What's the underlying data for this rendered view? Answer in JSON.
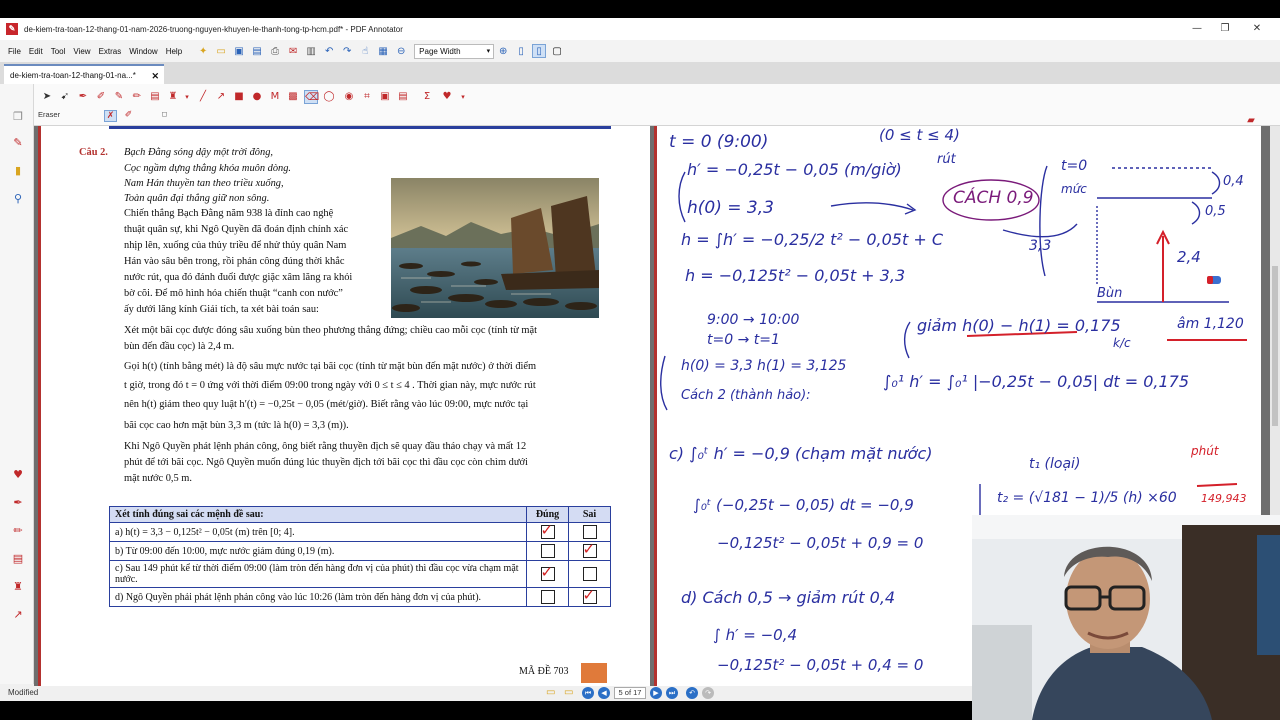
{
  "window": {
    "title": "de-kiem-tra-toan-12-thang-01-nam-2026-truong-nguyen-khuyen-le-thanh-tong-tp-hcm.pdf* - PDF Annotator",
    "app_icon": "pdf-annotator-icon"
  },
  "menu": {
    "items": [
      "File",
      "Edit",
      "Tool",
      "View",
      "Extras",
      "Window",
      "Help"
    ],
    "zoom_select": "Page Width"
  },
  "tab": {
    "label": "de-kiem-tra-toan-12-thang-01-na...*"
  },
  "toolbar": {
    "eraser_label": "Eraser"
  },
  "document": {
    "question_label": "Câu 2.",
    "poem": [
      "Bạch Đằng sóng dậy một trời đông,",
      "Cọc ngầm dựng thẳng khóa muôn dòng.",
      "Nam Hán thuyền tan theo triều xuống,",
      "Toàn quân đại thắng giữ non sông."
    ],
    "intro_lines": [
      "Chiến thắng Bạch Đằng năm 938 là đỉnh cao nghệ",
      "thuật quân sự, khi Ngô Quyền đã đoán định chính xác",
      "nhịp lên, xuống của thủy triều để nhử thủy quân Nam",
      "Hán vào sâu bên trong, rồi phản công đúng thời khắc",
      "nước rút, qua đó đánh đuổi được giặc xâm lăng ra khỏi",
      "bờ cõi. Để mô hình hóa chiến thuật “canh con nước”",
      "ấy dưới lăng kính Giải tích, ta xét bài toán sau:"
    ],
    "para1": [
      "Xét một bãi cọc được đóng sâu xuống bùn theo phương thẳng đứng; chiều cao mỗi cọc (tính từ mặt",
      "bùn đến đầu cọc) là  2,4 m."
    ],
    "para2": [
      "Gọi  h(t) (tính bằng mét) là độ sâu mực nước tại bãi cọc (tính từ mặt bùn đến mặt nước) ở thời điểm",
      "t giờ, trong đó  t = 0  ứng với thời điểm 09:00 trong ngày với  0 ≤ t ≤ 4 . Thời gian này, mực nước rút",
      "nên  h(t)  giảm theo quy luật  h′(t) = −0,25t − 0,05  (mét/giờ). Biết rằng vào lúc 09:00, mực nước tại",
      "bãi cọc cao hơn mặt bùn 3,3 m (tức là  h(0) = 3,3  (m))."
    ],
    "para3": [
      "Khi Ngô Quyền phát lệnh phản công, ông biết rằng thuyền địch sẽ quay đầu tháo chạy và mất 12",
      "phút để tới bãi cọc. Ngô Quyền muốn đúng lúc thuyền địch tới bãi cọc thì đầu cọc còn chìm dưới",
      "mặt nước 0,5 m."
    ],
    "table": {
      "header": [
        "Xét tính đúng sai các mệnh đề sau:",
        "Đúng",
        "Sai"
      ],
      "rows": [
        {
          "text": "a)  h(t) = 3,3 − 0,125t² − 0,05t  (m) trên [0; 4].",
          "true_checked": true,
          "false_checked": false
        },
        {
          "text": "b)  Từ 09:00 đến 10:00, mực nước giảm đúng 0,19 (m).",
          "true_checked": false,
          "false_checked": true
        },
        {
          "text": "c)  Sau 149 phút kể từ thời điểm 09:00 (làm tròn đến hàng đơn vị của phút) thì đầu cọc vừa chạm mặt nước.",
          "true_checked": true,
          "false_checked": false
        },
        {
          "text": "d)  Ngô Quyền phải phát lệnh phản công vào lúc 10:26 (làm tròn đến hàng đơn vị của phút).",
          "true_checked": false,
          "false_checked": true
        }
      ]
    },
    "footer_code": "MÃ ĐỀ 703"
  },
  "handwriting": {
    "lines": [
      "t = 0  (9:00)",
      "(0 ≤ t ≤ 4)",
      "h′ = −0,25t − 0,05  (m/giờ)",
      "rút",
      "h(0) = 3,3",
      "CÁCH 0,9",
      "h = ∫h′ = −0,25/2 t² − 0,05t + C",
      "h = −0,125t² − 0,05t + 3,3",
      "t=0",
      "mức",
      "0,4",
      "0,5",
      "3,3",
      "2,4",
      "Bùn",
      "9:00 → 10:00",
      "t=0 → t=1",
      "giảm  h(0) − h(1) = 0,175",
      "h(0) = 3,3    h(1) = 3,125",
      "k/c",
      "âm 1,120",
      "Cách 2 (thành hảo):",
      "∫₀¹ h′ = ∫₀¹ |−0,25t − 0,05| dt = 0,175",
      "c)  ∫₀ᵗ h′ = −0,9  (chạm mặt nước)",
      "∫₀ᵗ (−0,25t − 0,05) dt = −0,9",
      "−0,125t² − 0,05t + 0,9 = 0",
      "t₁ (loại)",
      "t₂ = (√181 − 1)/5  (h)   ×60",
      "phút",
      "149,943",
      "d)  Cách 0,5 → giảm rút 0,4",
      "∫ h′ = −0,4",
      "−0,125t² − 0,05t + 0,4 = 0"
    ]
  },
  "statusbar": {
    "status": "Modified",
    "page_indicator": "5 of 17"
  },
  "colors": {
    "accent_red": "#c0282a",
    "table_border": "#2a3f9d",
    "ink_blue": "#2a2fa0",
    "ink_red": "#d4202a"
  }
}
